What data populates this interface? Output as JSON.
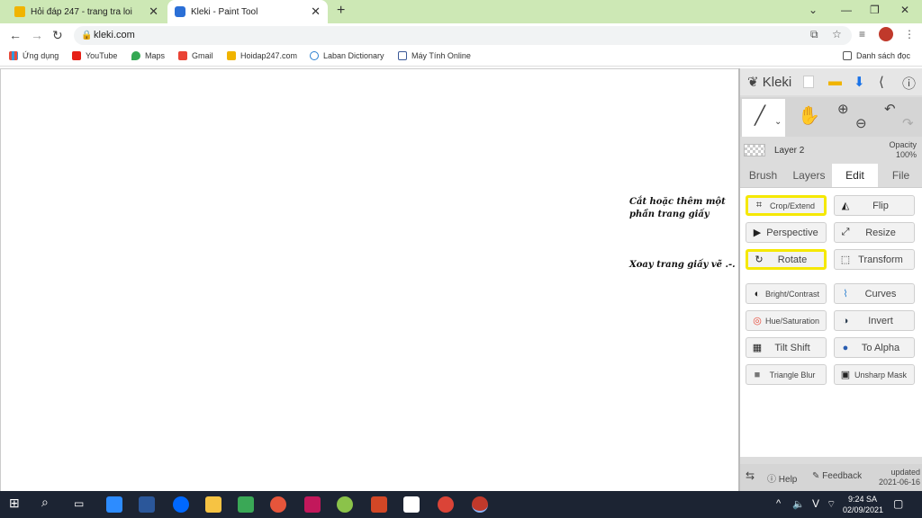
{
  "browser": {
    "tabs": [
      {
        "title": "Hỏi đáp 247 - trang tra loi",
        "active": false
      },
      {
        "title": "Kleki - Paint Tool",
        "active": true
      }
    ],
    "url": "kleki.com",
    "bookmarks": [
      {
        "label": "Ứng dụng",
        "icon": "apps-grid-icon"
      },
      {
        "label": "YouTube",
        "icon": "youtube-icon"
      },
      {
        "label": "Maps",
        "icon": "maps-pin-icon"
      },
      {
        "label": "Gmail",
        "icon": "gmail-icon"
      },
      {
        "label": "Hoidap247.com",
        "icon": "hoidap-icon"
      },
      {
        "label": "Laban Dictionary",
        "icon": "laban-icon"
      },
      {
        "label": "Máy Tính Online",
        "icon": "calculator-icon"
      }
    ],
    "reading_list": "Danh sách đọc",
    "colors": {
      "tabstrip": "#cde8b5",
      "accent": "#f5e800"
    }
  },
  "canvas": {
    "notes": [
      {
        "lines": [
          "Cắt hoặc thêm một",
          "phần trang giấy"
        ]
      },
      {
        "lines": [
          "Xoay trang giấy vẽ .-."
        ]
      }
    ]
  },
  "kleki": {
    "logo": "Kleki",
    "layer": {
      "name": "Layer 2",
      "opacity_label": "Opacity",
      "opacity_value": "100%"
    },
    "tabs": [
      "Brush",
      "Layers",
      "Edit",
      "File"
    ],
    "active_tab": "Edit",
    "buttons": [
      {
        "label": "Crop/Extend",
        "icon": "crop-icon",
        "highlight": true,
        "small": true
      },
      {
        "label": "Flip",
        "icon": "flip-icon",
        "highlight": false,
        "small": false
      },
      {
        "label": "Perspective",
        "icon": "perspective-icon",
        "highlight": false,
        "small": false
      },
      {
        "label": "Resize",
        "icon": "resize-icon",
        "highlight": false,
        "small": false
      },
      {
        "label": "Rotate",
        "icon": "rotate-icon",
        "highlight": true,
        "small": false
      },
      {
        "label": "Transform",
        "icon": "transform-icon",
        "highlight": false,
        "small": false
      },
      {
        "label": "Bright/Contrast",
        "icon": "contrast-icon",
        "highlight": false,
        "small": true
      },
      {
        "label": "Curves",
        "icon": "curves-icon",
        "highlight": false,
        "small": false
      },
      {
        "label": "Hue/Saturation",
        "icon": "hue-icon",
        "highlight": false,
        "small": true
      },
      {
        "label": "Invert",
        "icon": "invert-icon",
        "highlight": false,
        "small": false
      },
      {
        "label": "Tilt Shift",
        "icon": "tilt-shift-icon",
        "highlight": false,
        "small": false
      },
      {
        "label": "To Alpha",
        "icon": "to-alpha-icon",
        "highlight": false,
        "small": false
      },
      {
        "label": "Triangle Blur",
        "icon": "blur-icon",
        "highlight": false,
        "small": true
      },
      {
        "label": "Unsharp Mask",
        "icon": "unsharp-icon",
        "highlight": false,
        "small": true
      }
    ],
    "footer": {
      "help": "Help",
      "feedback": "Feedback",
      "updated_label": "updated",
      "updated_date": "2021-06-16"
    }
  },
  "taskbar": {
    "time": "9:24 SA",
    "date": "02/09/2021",
    "lang": "V"
  }
}
